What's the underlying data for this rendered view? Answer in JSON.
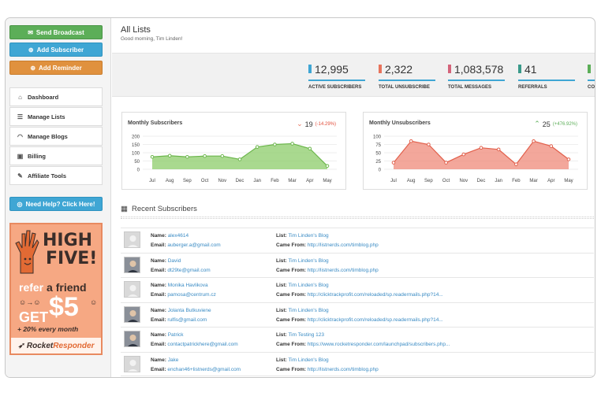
{
  "sidebar": {
    "send_broadcast": "Send Broadcast",
    "add_subscriber": "Add Subscriber",
    "add_reminder": "Add Reminder",
    "nav": [
      {
        "label": "Dashboard",
        "icon": "home-icon"
      },
      {
        "label": "Manage Lists",
        "icon": "list-icon"
      },
      {
        "label": "Manage Blogs",
        "icon": "rss-icon"
      },
      {
        "label": "Billing",
        "icon": "billing-icon"
      },
      {
        "label": "Affiliate Tools",
        "icon": "wrench-icon"
      }
    ],
    "help": "Need Help? Click Here!",
    "promo": {
      "high": "HIGH",
      "five": "FIVE!",
      "refer": "refer",
      "a_friend": "a friend",
      "get": "GET",
      "amount": "$5",
      "every": "+ 20% every month",
      "brand_a": "Rocket",
      "brand_b": "Responder"
    }
  },
  "header": {
    "title": "All Lists",
    "greeting": "Good morning, Tim Linden!"
  },
  "stats": [
    {
      "value": "12,995",
      "label": "ACTIVE SUBSCRIBERS",
      "color": "#3fa6d4"
    },
    {
      "value": "2,322",
      "label": "TOTAL UNSUBSCRIBE",
      "color": "#e8735c"
    },
    {
      "value": "1,083,578",
      "label": "TOTAL MESSAGES",
      "color": "#d4637a"
    },
    {
      "value": "41",
      "label": "REFERRALS",
      "color": "#3a9a8a"
    },
    {
      "value": "",
      "label": "CO",
      "color": "#5cae58"
    }
  ],
  "charts": {
    "subscribers": {
      "title": "Monthly Subscribers",
      "delta": "19",
      "pct": "(-14.29%)",
      "arrow": "down"
    },
    "unsubscribers": {
      "title": "Monthly Unsubscribers",
      "delta": "25",
      "pct": "(+476.92%)",
      "arrow": "up"
    }
  },
  "chart_data": [
    {
      "type": "area",
      "categories": [
        "Jul",
        "Aug",
        "Sep",
        "Oct",
        "Nov",
        "Dec",
        "Jan",
        "Feb",
        "Mar",
        "Apr",
        "May"
      ],
      "values": [
        75,
        82,
        75,
        80,
        80,
        60,
        135,
        150,
        155,
        125,
        20
      ],
      "yticks": [
        0,
        50,
        100,
        150,
        200
      ],
      "ylim": [
        0,
        200
      ],
      "color": "#8ccc6a"
    },
    {
      "type": "area",
      "categories": [
        "Jul",
        "Aug",
        "Sep",
        "Oct",
        "Nov",
        "Dec",
        "Jan",
        "Feb",
        "Mar",
        "Apr",
        "May"
      ],
      "values": [
        20,
        85,
        75,
        20,
        45,
        65,
        60,
        15,
        85,
        70,
        30
      ],
      "yticks": [
        0,
        25,
        50,
        75,
        100
      ],
      "ylim": [
        0,
        100
      ],
      "color": "#ef8a7a"
    }
  ],
  "recent": {
    "title": "Recent Subscribers",
    "name_key": "Name:",
    "email_key": "Email:",
    "list_key": "List:",
    "came_key": "Came From:",
    "rows": [
      {
        "name": "alex4614",
        "email": "auberger.a@gmail.com",
        "list": "Tim Linden's Blog",
        "came": "http://listnerds.com/timblog.php",
        "photo": false
      },
      {
        "name": "David",
        "email": "dt29te@gmail.com",
        "list": "Tim Linden's Blog",
        "came": "http://listnerds.com/timblog.php",
        "photo": true
      },
      {
        "name": "Monika Havlikova",
        "email": "pamosa@centrum.cz",
        "list": "Tim Linden's Blog",
        "came": "http://clicktrackprofit.com/reloaded/sp.readermails.php?14...",
        "photo": false
      },
      {
        "name": "Jolanta Butkuviene",
        "email": "rulfis@gmail.com",
        "list": "Tim Linden's Blog",
        "came": "http://clicktrackprofit.com/reloaded/sp.readermails.php?14...",
        "photo": true
      },
      {
        "name": "Patrick",
        "email": "contactpatrickhere@gmail.com",
        "list": "Tim Testing 123",
        "came": "https://www.rocketresponder.com/launchpad/subscribers.php...",
        "photo": true
      },
      {
        "name": "Jake",
        "email": "enchan46+listnerds@gmail.com",
        "list": "Tim Linden's Blog",
        "came": "http://listnerds.com/timblog.php",
        "photo": false
      }
    ]
  }
}
